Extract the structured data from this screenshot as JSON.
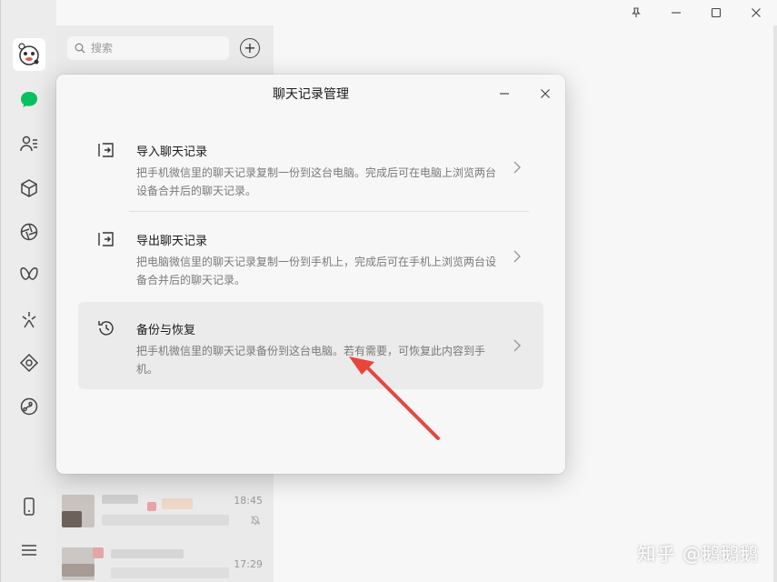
{
  "window": {
    "pin_label": "pin",
    "controls": [
      "minimize",
      "maximize",
      "close"
    ]
  },
  "sidebar": {
    "icons": [
      "chat-icon",
      "contacts-icon",
      "favorites-icon",
      "moments-icon",
      "channels-icon",
      "discover-icon",
      "mini-program-icon",
      "miniapp-icon"
    ],
    "bottom_icons": [
      "phone-icon",
      "menu-icon"
    ]
  },
  "chatlist": {
    "search_placeholder": "搜索",
    "rows": [
      {
        "time": "18:45",
        "muted": true
      },
      {
        "time": "17:29",
        "muted": false
      }
    ]
  },
  "dialog": {
    "title": "聊天记录管理",
    "options": [
      {
        "title": "导入聊天记录",
        "desc": "把手机微信里的聊天记录复制一份到这台电脑。完成后可在电脑上浏览两台设备合并后的聊天记录。"
      },
      {
        "title": "导出聊天记录",
        "desc": "把电脑微信里的聊天记录复制一份到手机上，完成后可在手机上浏览两台设备合并后的聊天记录。"
      },
      {
        "title": "备份与恢复",
        "desc": "把手机微信里的聊天记录备份到这台电脑。若有需要，可恢复此内容到手机。"
      }
    ]
  },
  "watermark": "知乎 @鹅鹅鹅",
  "colors": {
    "accent_green": "#07c160",
    "arrow_red": "#e8453c"
  }
}
